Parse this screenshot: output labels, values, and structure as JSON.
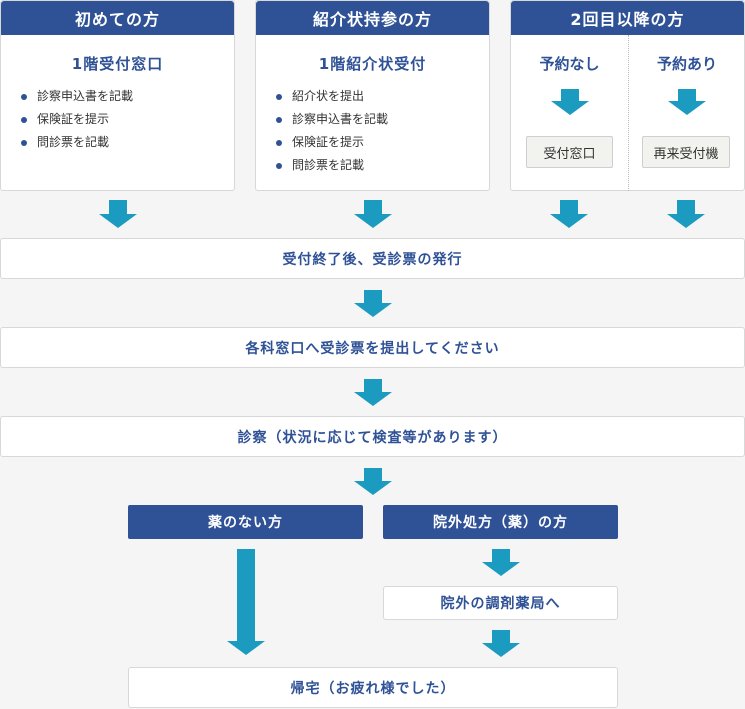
{
  "columns": {
    "first": {
      "header": "初めての方",
      "title": "1階受付窓口",
      "items": [
        "診察申込書を記載",
        "保険証を提示",
        "問診票を記載"
      ]
    },
    "referral": {
      "header": "紹介状持参の方",
      "title": "1階紹介状受付",
      "items": [
        "紹介状を提出",
        "診察申込書を記載",
        "保険証を提示",
        "問診票を記載"
      ]
    },
    "repeat": {
      "header": "2回目以降の方",
      "no_appointment": {
        "label": "予約なし",
        "box": "受付窓口"
      },
      "appointment": {
        "label": "予約あり",
        "box": "再来受付機"
      }
    }
  },
  "steps": {
    "s1": "受付終了後、受診票の発行",
    "s2": "各科窓口へ受診票を提出してください",
    "s3": "診察（状況に応じて検査等があります）"
  },
  "branches": {
    "no_medicine": "薬のない方",
    "outside_medicine": "院外処方（薬）の方",
    "pharmacy": "院外の調剤薬局へ"
  },
  "final": "帰宅（お疲れ様でした）",
  "colors": {
    "header_blue": "#2f5296",
    "arrow_teal": "#1b9bbf",
    "background": "#f5f5f5"
  }
}
